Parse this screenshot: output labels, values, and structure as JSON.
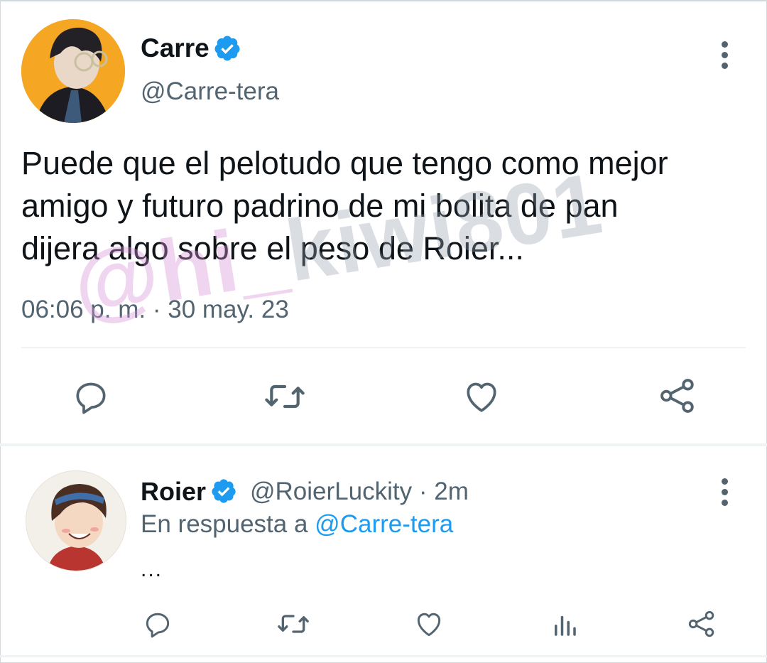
{
  "tweet": {
    "author_name": "Carre",
    "author_handle": "@Carre-tera",
    "text_line_1": "Puede que el pelotudo que tengo como mejor",
    "text_line_2": "amigo y futuro padrino de mi bolita de pan",
    "text_line_3": "dijera algo sobre el peso de Roier...",
    "time": "06:06 p. m.",
    "separator": "·",
    "date": "30 may. 23",
    "actions": [
      "reply-icon",
      "retweet-icon",
      "like-icon",
      "share-icon"
    ]
  },
  "reply": {
    "author_name": "Roier",
    "author_handle": "@RoierLuckity",
    "separator": "·",
    "time_ago": "2m",
    "reply_prefix": "En respuesta a",
    "reply_to": "@Carre-tera",
    "text": "...",
    "actions": [
      "reply-icon",
      "retweet-icon",
      "like-icon",
      "analytics-icon",
      "share-icon"
    ]
  },
  "watermark": {
    "prefix": "@hi_",
    "suffix": "kiwi801"
  },
  "colors": {
    "verified_blue": "#1d9bf0",
    "link_blue": "#1d9bf0",
    "muted_gray": "#536471",
    "text_dark": "#0f1419",
    "avatar_orange": "#f5a623"
  }
}
